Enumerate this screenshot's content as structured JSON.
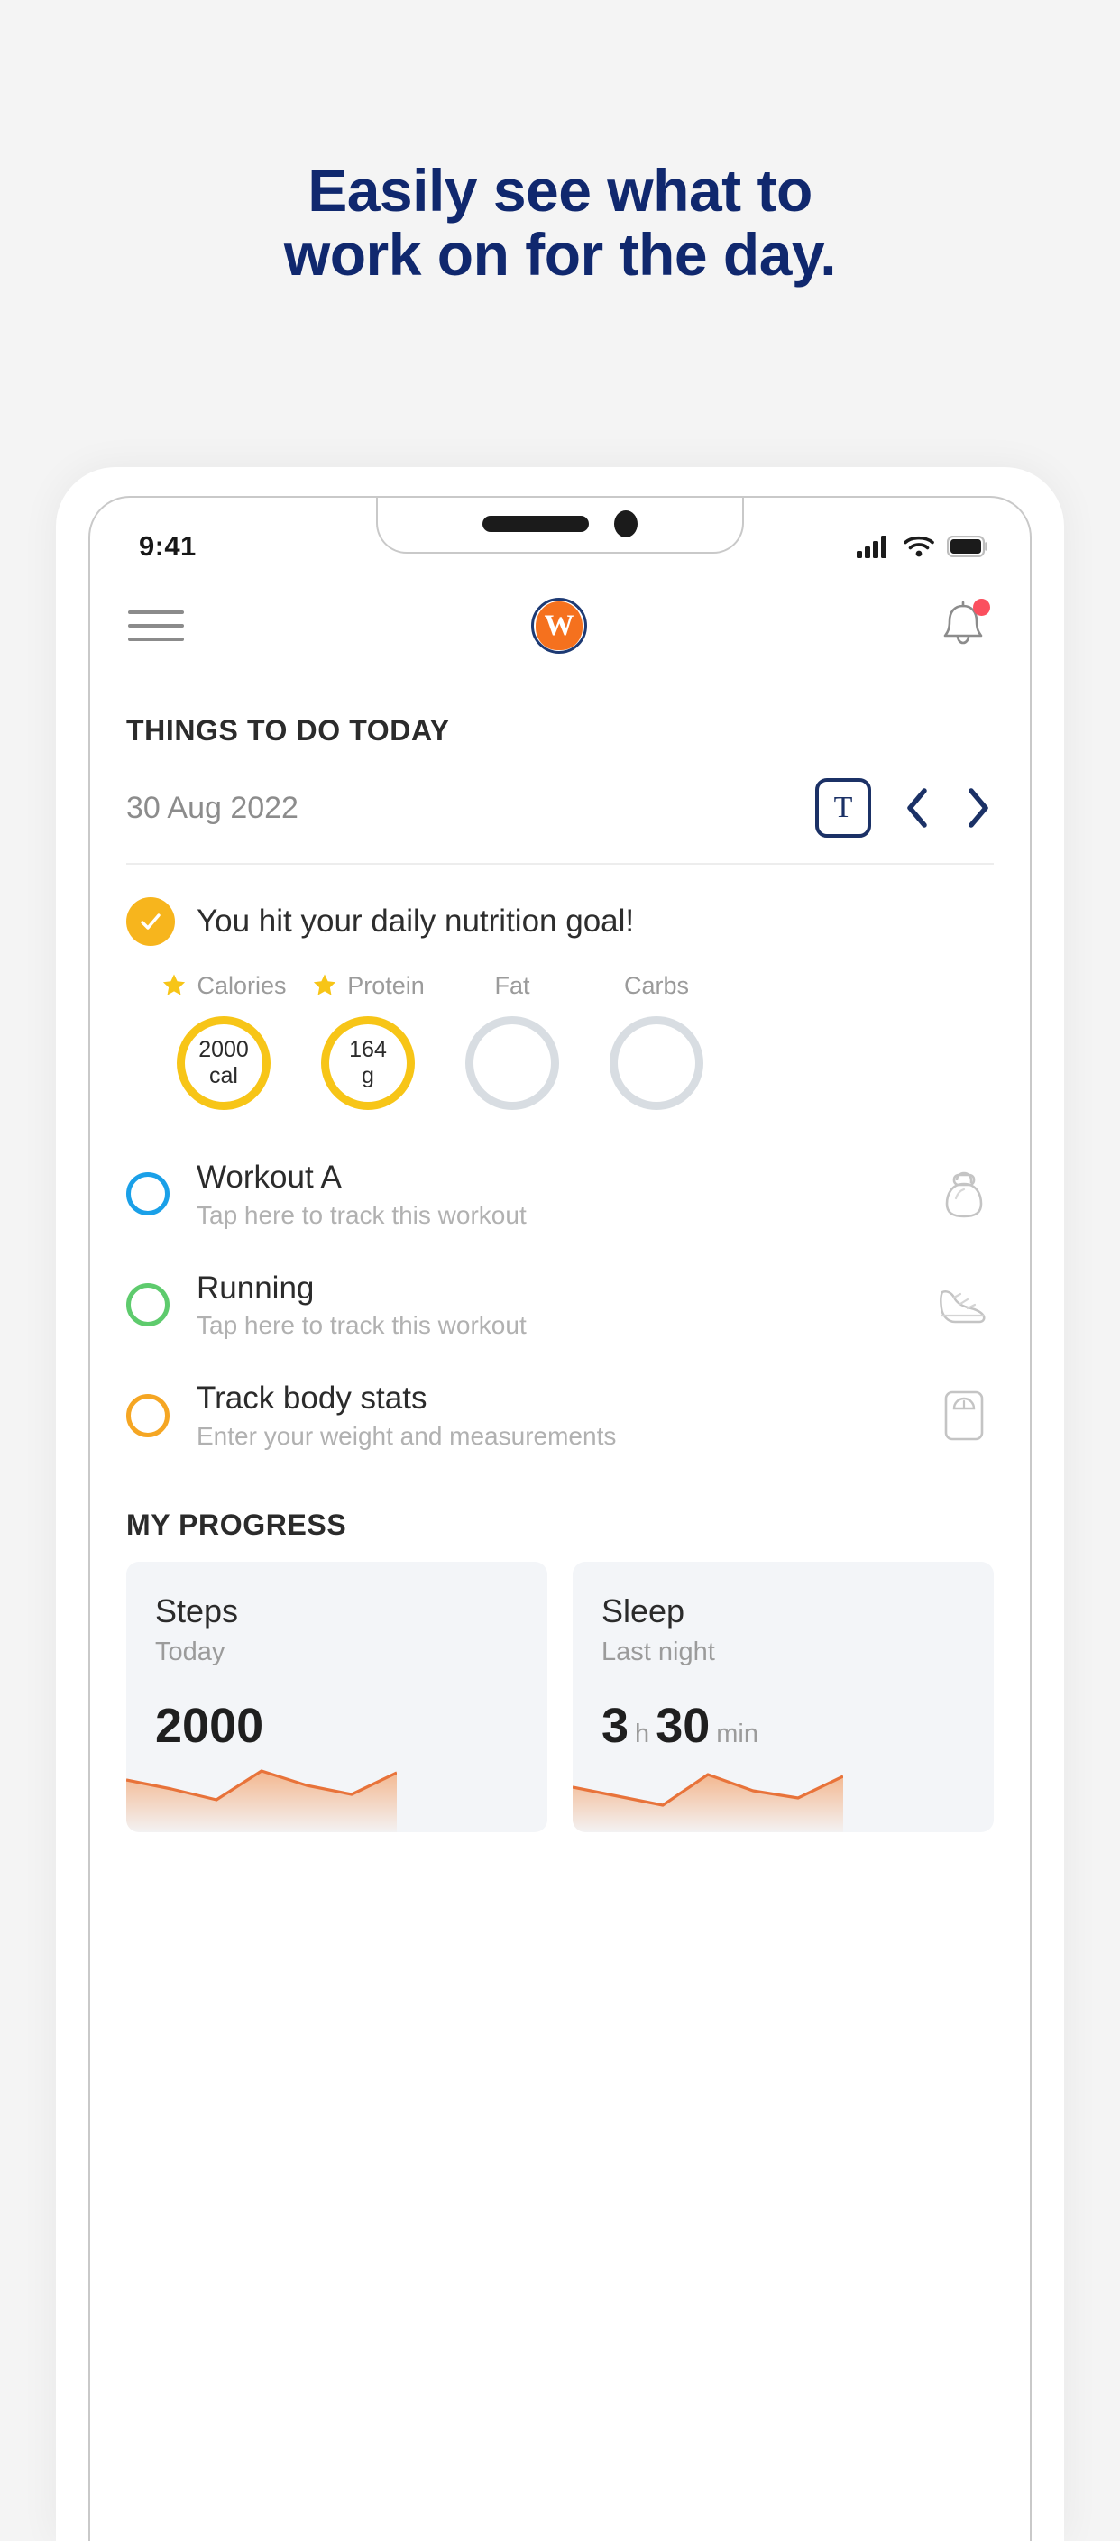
{
  "promo": {
    "line1": "Easily see what to",
    "line2": "work on for the day.",
    "color": "#10286E"
  },
  "statusbar": {
    "time": "9:41",
    "signal_icon": "cellular-signal-icon",
    "wifi_icon": "wifi-icon",
    "battery_icon": "battery-icon"
  },
  "appbar": {
    "menu_icon": "hamburger-menu-icon",
    "logo_icon": "app-logo-icon",
    "logo_letter": "W",
    "notifications_icon": "bell-icon",
    "has_notification_badge": true,
    "badge_color": "#FB4F5E"
  },
  "things_to_do": {
    "heading": "THINGS TO DO TODAY",
    "date": "30 Aug 2022",
    "today_button": "T",
    "prev_icon": "chevron-left-icon",
    "next_icon": "chevron-right-icon"
  },
  "nutrition": {
    "status_icon": "checkmark-icon",
    "status_color": "#F7B51D",
    "message": "You hit your daily nutrition goal!",
    "macros": [
      {
        "name": "Calories",
        "value": "2000",
        "unit": "cal",
        "starred": true,
        "complete": true
      },
      {
        "name": "Protein",
        "value": "164",
        "unit": "g",
        "starred": true,
        "complete": true
      },
      {
        "name": "Fat",
        "value": "",
        "unit": "",
        "starred": false,
        "complete": false
      },
      {
        "name": "Carbs",
        "value": "",
        "unit": "",
        "starred": false,
        "complete": false
      }
    ]
  },
  "tasks": [
    {
      "title": "Workout A",
      "subtitle": "Tap here to track this workout",
      "color": "blue",
      "icon": "kettlebell-icon"
    },
    {
      "title": "Running",
      "subtitle": "Tap here to track this workout",
      "color": "green",
      "icon": "running-shoe-icon"
    },
    {
      "title": "Track body stats",
      "subtitle": "Enter your weight and measurements",
      "color": "orange",
      "icon": "weight-scale-icon"
    }
  ],
  "my_progress": {
    "heading": "MY PROGRESS",
    "cards": [
      {
        "title": "Steps",
        "subtitle": "Today",
        "value": "2000",
        "unit": "",
        "value2": "",
        "unit2": ""
      },
      {
        "title": "Sleep",
        "subtitle": "Last night",
        "value": "3",
        "unit": "h",
        "value2": "30",
        "unit2": "min"
      }
    ]
  },
  "chart_data": [
    {
      "type": "area",
      "title": "Steps",
      "x": [
        0,
        1,
        2,
        3,
        4,
        5,
        6
      ],
      "values": [
        58,
        44,
        34,
        68,
        50,
        40,
        66
      ],
      "ylim": [
        0,
        100
      ],
      "line_color": "#E8733A",
      "fill_color": "#F6C6A4",
      "grid": false,
      "legend": "none"
    },
    {
      "type": "area",
      "title": "Sleep",
      "x": [
        0,
        1,
        2,
        3,
        4,
        5,
        6
      ],
      "values": [
        50,
        38,
        30,
        66,
        46,
        38,
        64
      ],
      "ylim": [
        0,
        100
      ],
      "line_color": "#E8733A",
      "fill_color": "#F6C6A4",
      "grid": false,
      "legend": "none"
    }
  ]
}
